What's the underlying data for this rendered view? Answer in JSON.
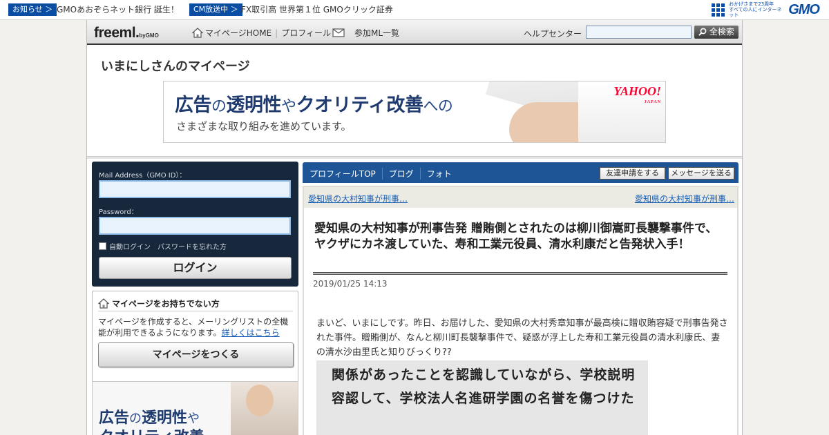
{
  "gmobar": {
    "tag1": "お知らせ ＞",
    "text1": "GMOあおぞらネット銀行 誕生！",
    "tag2": "CM放送中 ＞",
    "text2": "FX取引高 世界第１位 GMOクリック証券",
    "anniv_line1": "おかげさまで23周年",
    "anniv_line2": "すべての人にインターネット",
    "logo": "GMO"
  },
  "nav": {
    "logo": "freeml.",
    "logo_by": "byGMO",
    "home": "マイページHOME",
    "profile": "プロフィール",
    "joined": "参加ML一覧",
    "help": "ヘルプセンター",
    "search_button": "全検索",
    "search_value": ""
  },
  "page": {
    "title": "いまにしさんのマイページ"
  },
  "banner": {
    "w1": "広告",
    "w2": "の",
    "w3": "透明性",
    "w4": "や",
    "w5": "クオリティ改善",
    "w6": "への",
    "line2": "さまざまな取り組みを進めています。",
    "brand": "YAHOO!",
    "brand_sub": "JAPAN"
  },
  "login": {
    "mail_label": "Mail Address（GMO ID）：",
    "password_label": "Password：",
    "auto_login": "自動ログイン",
    "forgot": "パスワードを忘れた方",
    "button": "ログイン"
  },
  "nopage": {
    "title": "マイページをお持ちでない方",
    "body": "マイページを作成すると、メーリングリストの全機能が利用できるようになります。",
    "link": "詳しくはこちら",
    "button": "マイページをつくる"
  },
  "sidead": {
    "w1": "広告",
    "w2": "の",
    "w3": "透明性",
    "w4": "や",
    "line2": "クオリティ改善"
  },
  "tabs": {
    "items": [
      "プロフィールTOP",
      "ブログ",
      "フォト"
    ],
    "friend": "友達申請をする",
    "message": "メッセージを送る"
  },
  "article": {
    "prev": "愛知県の大村知事が刑事…",
    "next": "愛知県の大村知事が刑事…",
    "title": "愛知県の大村知事が刑事告発 贈賄側とされたのは柳川御嵩町長襲撃事件で、ヤクザにカネ渡していた、寿和工業元役員、清水利康だと告発状入手！",
    "date": "2019/01/25 14:13",
    "body": "まいど、いまにしです。昨日、お届けした、愛知県の大村秀章知事が最高検に贈収賄容疑で刑事告発された事件。贈賄側が、なんと柳川町長襲撃事件で、疑惑が浮上した寿和工業元役員の清水利康氏、妻の清水沙由里氏と知りびっくり??",
    "photo_line1": "関係があったことを認識していながら、学校説明",
    "photo_line2": "容認して、学校法人名進研学園の名誉を傷つけた"
  }
}
